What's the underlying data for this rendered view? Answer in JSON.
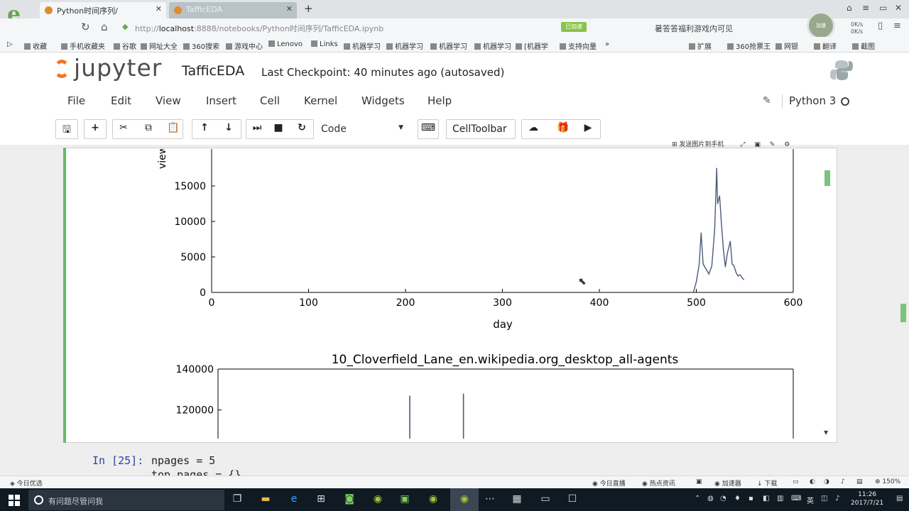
{
  "browser": {
    "tabs": [
      {
        "label": "Python时间序列/",
        "active": true
      },
      {
        "label": "TafficEDA",
        "active": false
      }
    ],
    "url_prefix": "http://",
    "url_host": "localhost",
    "url_rest": ":8888/notebooks/Python时间序列/TafficEDA.ipynb",
    "url_badge": "已加速",
    "promo_text": "暑答答福利游戏内可见",
    "speed_up": "0K/s",
    "speed_down": "0K/s",
    "bookmarks": [
      "收藏",
      "手机收藏夹",
      "谷歌",
      "网址大全",
      "360搜索",
      "游戏中心",
      "Lenovo",
      "Links",
      "机器学习",
      "机器学习",
      "机器学习",
      "机器学习",
      "[机器学",
      "支持向量"
    ],
    "bookmarks_right": [
      "扩展",
      "360抢票王",
      "网银",
      "翻译",
      "截图"
    ]
  },
  "notebook": {
    "logo_text": "jupyter",
    "name": "TafficEDA",
    "checkpoint": "Last Checkpoint: 40 minutes ago (autosaved)",
    "menu": [
      "File",
      "Edit",
      "View",
      "Insert",
      "Cell",
      "Kernel",
      "Widgets",
      "Help"
    ],
    "kernel": "Python 3",
    "cell_type": "Code",
    "cell_toolbar": "CellToolbar",
    "cell_tools_label": "发送图片到手机",
    "prompt": "In [25]:",
    "code_line1": "npages = 5",
    "code_line2": "top_pages = {}"
  },
  "chart_data": [
    {
      "type": "line",
      "title": "",
      "xlabel": "day",
      "ylabel": "views",
      "xlim": [
        0,
        600
      ],
      "ylim": [
        0,
        17500
      ],
      "xticks": [
        0,
        100,
        200,
        300,
        400,
        500,
        600
      ],
      "yticks": [
        0,
        5000,
        10000,
        15000
      ],
      "color": "#4c5b78",
      "x": [
        0,
        100,
        200,
        300,
        400,
        497,
        500,
        503,
        505,
        507,
        510,
        513,
        516,
        519,
        521,
        522,
        524,
        526,
        528,
        530,
        532,
        535,
        537,
        539,
        541,
        543,
        545,
        547,
        549
      ],
      "y": [
        0,
        0,
        0,
        0,
        0,
        0,
        1500,
        4000,
        8400,
        4000,
        3300,
        2600,
        3700,
        8900,
        17500,
        12500,
        13600,
        9500,
        6000,
        3600,
        5500,
        7200,
        4000,
        3700,
        2800,
        2300,
        2500,
        2100,
        1800
      ]
    },
    {
      "type": "line",
      "title": "10_Cloverfield_Lane_en.wikipedia.org_desktop_all-agents",
      "xlabel": "",
      "ylabel": "",
      "yticks": [
        120000,
        140000
      ],
      "visible_ylim": [
        106000,
        140000
      ],
      "color": "#4c5b78",
      "spikes_x": [
        200,
        256
      ],
      "spikes_y": [
        127000,
        128000
      ]
    }
  ],
  "statusbar": {
    "left": "今日优选",
    "right": [
      "今日直播",
      "热点资讯",
      "",
      "加速器",
      "下载",
      "",
      "",
      "150%"
    ]
  },
  "taskbar": {
    "search_placeholder": "有问题尽管问我",
    "time": "11:26",
    "date": "2017/7/21",
    "ime": "英"
  }
}
